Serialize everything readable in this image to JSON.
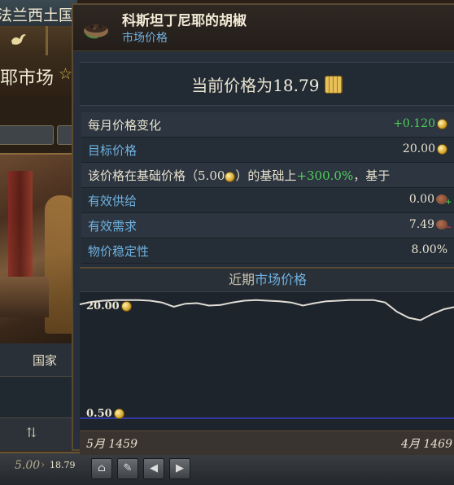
{
  "background": {
    "title_fragment": "法兰西土国",
    "market_title": "耶市场",
    "country_label": "国家",
    "bottom_price_old": "5.00",
    "bottom_price_new": "18.79"
  },
  "tooltip": {
    "title": "科斯坦丁尼耶的胡椒",
    "subtitle": "市场价格",
    "current_price_prefix": "当前价格为",
    "current_price": "18.79",
    "rows": [
      {
        "label": "每月价格变化",
        "value": "+0.120"
      },
      {
        "label": "目标价格",
        "value": "20.00"
      },
      {
        "label_prefix": "该价格在基础价格（",
        "base_price": "5.00",
        "label_mid": "）的基础上",
        "percent": "+300.0%",
        "label_suffix": "，基于"
      },
      {
        "label": "有效供给",
        "value": "0.00"
      },
      {
        "label": "有效需求",
        "value": "7.49"
      },
      {
        "label": "物价稳定性",
        "value": "8.00%"
      }
    ]
  },
  "chart_data": {
    "type": "line",
    "title_prefix": "近期",
    "title_link": "市场价格",
    "x_start": "5月 1459",
    "x_end": "4月 1469",
    "y_max_label": "20.00",
    "y_min_label": "0.50",
    "ylim": [
      0.5,
      20.0
    ],
    "series": [
      {
        "values": [
          19.2,
          19.6,
          19.8,
          19.9,
          19.9,
          19.9,
          19.8,
          19.5,
          18.8,
          19.3,
          19.4,
          19.0,
          19.1,
          19.5,
          19.8,
          19.9,
          19.8,
          19.7,
          19.5,
          19.0,
          19.4,
          19.7,
          19.8,
          19.9,
          19.9,
          19.9,
          19.5,
          18.0,
          17.0,
          16.6,
          17.6,
          18.4,
          18.8
        ]
      },
      {
        "values": [
          0.5,
          0.5
        ]
      }
    ],
    "colors": {
      "price_line": "#e0ddd6",
      "baseline": "#3a40c8"
    }
  }
}
